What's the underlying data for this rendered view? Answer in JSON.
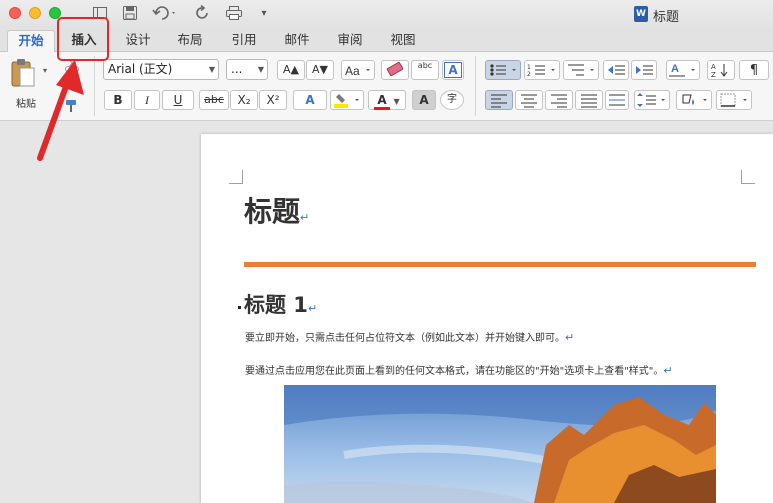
{
  "window": {
    "title": "标题"
  },
  "tabs": [
    "开始",
    "插入",
    "设计",
    "布局",
    "引用",
    "邮件",
    "审阅",
    "视图"
  ],
  "ribbon": {
    "paste_label": "粘贴",
    "font_name": "Arial (正文)",
    "font_size": "...",
    "font_size_up": "A▲",
    "font_size_down": "A▼",
    "bold": "B",
    "italic": "I",
    "underline": "U",
    "strike": "abc",
    "subscript": "X₂",
    "superscript": "X²",
    "abc_label": "abc",
    "text_effect": "A",
    "font_color": "A",
    "char_shading": "A",
    "phonetic": "字"
  },
  "document": {
    "title": "标题",
    "heading1": "标题 1",
    "paragraph1": "要立即开始，只需点击任何占位符文本（例如此文本）并开始键入即可。",
    "paragraph2": "要通过点击应用您在此页面上看到的任何文本格式，请在功能区的\"开始\"选项卡上查看\"样式\"。",
    "pilcrow": "↵"
  },
  "colors": {
    "accent": "#2a6ac8",
    "heading_rule": "#ed7d31",
    "annotation": "#e02a2a"
  },
  "icons": [
    "close-button",
    "minimize-button",
    "zoom-button",
    "sidebar-icon",
    "save-icon",
    "undo-icon",
    "redo-icon",
    "print-icon",
    "customize-icon",
    "word-document-icon",
    "paste-icon",
    "cut-icon",
    "format-painter-icon",
    "clear-formatting-icon",
    "highlight-icon",
    "bullets-icon",
    "numbering-icon",
    "multilevel-list-icon",
    "decrease-indent-icon",
    "increase-indent-icon",
    "sort-icon",
    "show-marks-icon",
    "align-left-icon",
    "center-icon",
    "align-right-icon",
    "justify-icon",
    "line-spacing-icon",
    "shading-icon",
    "borders-icon",
    "red-arrow"
  ]
}
